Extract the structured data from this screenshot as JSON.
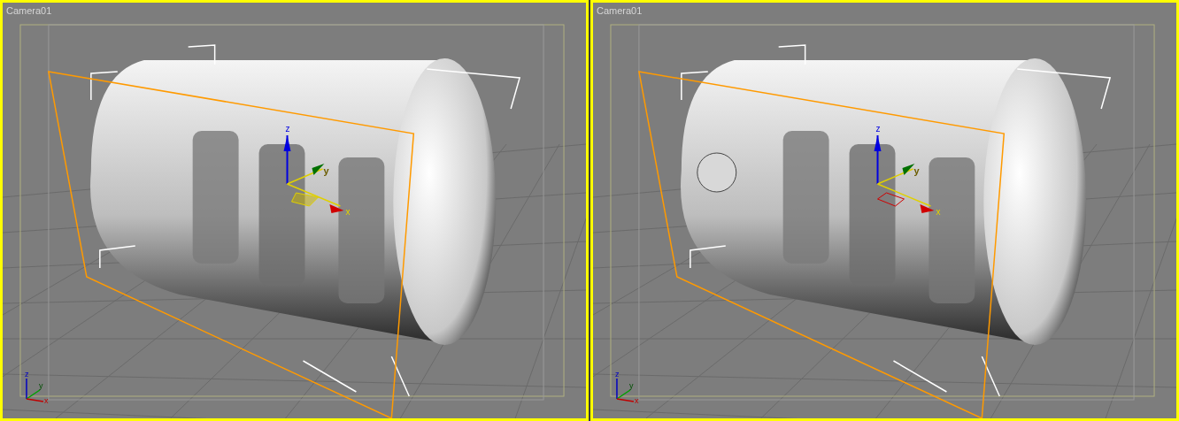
{
  "viewports": [
    {
      "label": "Camera01",
      "selected": true,
      "sphere": false,
      "gizmo_labels": [
        "z",
        "y",
        "x"
      ],
      "triad_labels": [
        "z",
        "y",
        "x"
      ]
    },
    {
      "label": "Camera01",
      "selected": true,
      "sphere": true,
      "gizmo_labels": [
        "z",
        "y",
        "x"
      ],
      "triad_labels": [
        "z",
        "y",
        "x"
      ]
    }
  ]
}
